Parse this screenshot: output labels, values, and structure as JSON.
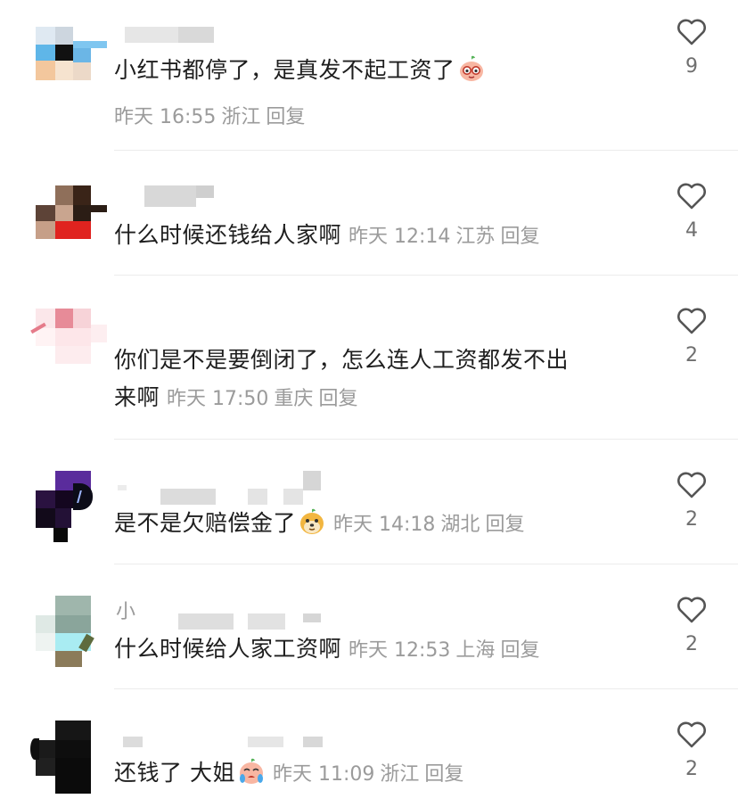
{
  "comments": [
    {
      "text": "小红书都停了，是真发不起工资了",
      "emoji": "glasses-peach-emoji",
      "time": "昨天 16:55",
      "location": "浙江",
      "reply": "回复",
      "likes": "9"
    },
    {
      "text": "什么时候还钱给人家啊",
      "time": "昨天 12:14",
      "location": "江苏",
      "reply": "回复",
      "likes": "4"
    },
    {
      "text_line1": "你们是不是要倒闭了，怎么连人工资都发不出",
      "text_line2": "来啊",
      "time": "昨天 17:50",
      "location": "重庆",
      "reply": "回复",
      "likes": "2"
    },
    {
      "text": "是不是欠赔偿金了",
      "emoji": "doge-emoji",
      "time": "昨天 14:18",
      "location": "湖北",
      "reply": "回复",
      "likes": "2"
    },
    {
      "name_char": "小",
      "text": "什么时候给人家工资啊",
      "time": "昨天 12:53",
      "location": "上海",
      "reply": "回复",
      "likes": "2"
    },
    {
      "text": "还钱了 大姐",
      "emoji": "crying-peach-emoji",
      "time": "昨天 11:09",
      "location": "浙江",
      "reply": "回复",
      "likes": "2"
    }
  ]
}
